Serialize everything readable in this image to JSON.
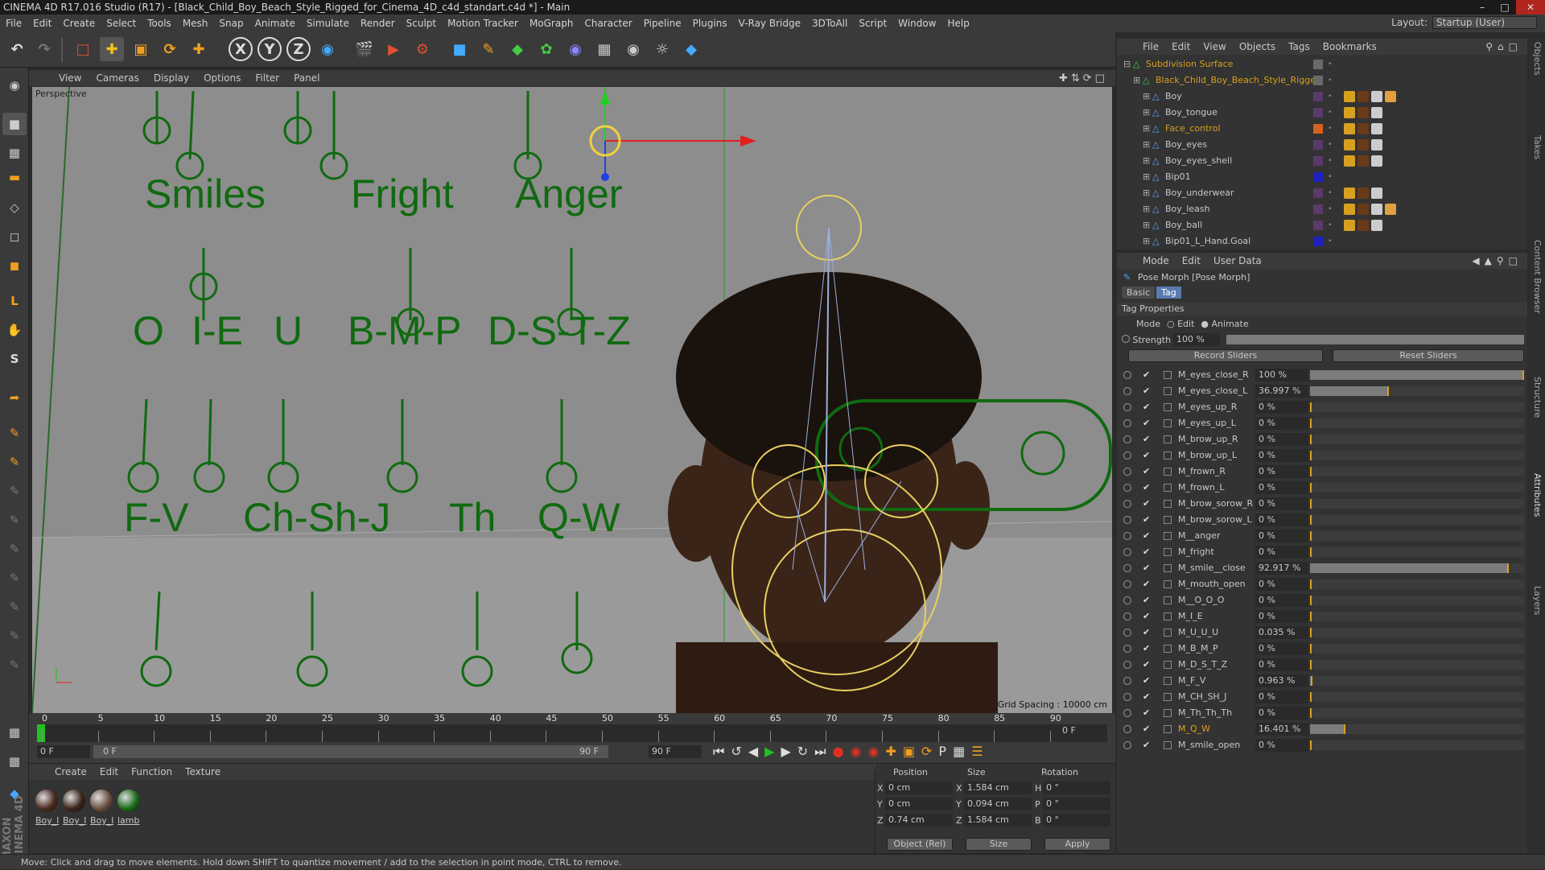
{
  "title": "CINEMA 4D R17.016 Studio (R17) - [Black_Child_Boy_Beach_Style_Rigged_for_Cinema_4D_c4d_standart.c4d *] - Main",
  "menu": [
    "File",
    "Edit",
    "Create",
    "Select",
    "Tools",
    "Mesh",
    "Snap",
    "Animate",
    "Simulate",
    "Render",
    "Sculpt",
    "Motion Tracker",
    "MoGraph",
    "Character",
    "Pipeline",
    "Plugins",
    "V-Ray Bridge",
    "3DToAll",
    "Script",
    "Window",
    "Help"
  ],
  "layout": {
    "label": "Layout:",
    "value": "Startup (User)"
  },
  "viewport": {
    "menu": [
      "View",
      "Cameras",
      "Display",
      "Options",
      "Filter",
      "Panel"
    ],
    "label": "Perspective",
    "grid_spacing": "Grid Spacing : 10000 cm",
    "row1": [
      "Smiles",
      "Fright",
      "Anger"
    ],
    "row2": [
      "O",
      "I-E",
      "U",
      "B-M-P",
      "D-S-T-Z"
    ],
    "row3": [
      "F-V",
      "Ch-Sh-J",
      "Th",
      "Q-W"
    ]
  },
  "timeline": {
    "ticks": [
      "0",
      "5",
      "10",
      "15",
      "20",
      "25",
      "30",
      "35",
      "40",
      "45",
      "50",
      "55",
      "60",
      "65",
      "70",
      "75",
      "80",
      "85",
      "90"
    ],
    "current_frame": "0 F",
    "start": "0 F",
    "range_start": "0 F",
    "range_end": "90 F",
    "end": "90 F",
    "right_frame": "0 F"
  },
  "materials": {
    "menu": [
      "Create",
      "Edit",
      "Function",
      "Texture"
    ],
    "items": [
      {
        "label": "Boy_l",
        "color": "#4a2a1e"
      },
      {
        "label": "Boy_l",
        "color": "#3a2418"
      },
      {
        "label": "Boy_l",
        "color": "#6a5040"
      },
      {
        "label": "lamb",
        "color": "#1a6a1a"
      }
    ]
  },
  "coords": {
    "headers": [
      "Position",
      "Size",
      "Rotation"
    ],
    "rows": [
      {
        "axis": "X",
        "pos": "0 cm",
        "size_axis": "X",
        "size": "1.584 cm",
        "rot_axis": "H",
        "rot": "0 °"
      },
      {
        "axis": "Y",
        "pos": "0 cm",
        "size_axis": "Y",
        "size": "0.094 cm",
        "rot_axis": "P",
        "rot": "0 °"
      },
      {
        "axis": "Z",
        "pos": "0.74 cm",
        "size_axis": "Z",
        "size": "1.584 cm",
        "rot_axis": "B",
        "rot": "0 °"
      }
    ],
    "mode": "Object (Rel)",
    "size_mode": "Size",
    "apply": "Apply"
  },
  "status": "Move: Click and drag to move elements. Hold down SHIFT to quantize movement / add to the selection in point mode, CTRL to remove.",
  "objects": {
    "menu": [
      "File",
      "Edit",
      "View",
      "Objects",
      "Tags",
      "Bookmarks"
    ],
    "items": [
      {
        "name": "Subdivision Surface",
        "color": "#d8a020",
        "indent": 0,
        "clr": "#6a6a6a"
      },
      {
        "name": "Black_Child_Boy_Beach_Style_Rigged",
        "color": "#d8a020",
        "indent": 1,
        "clr": "#6a6a6a"
      },
      {
        "name": "Boy",
        "color": "#c8c8c8",
        "indent": 2,
        "clr": "#5a3a6a"
      },
      {
        "name": "Boy_tongue",
        "color": "#c8c8c8",
        "indent": 2,
        "clr": "#5a3a6a"
      },
      {
        "name": "Face_control",
        "color": "#d8a020",
        "indent": 2,
        "clr": "#d86020"
      },
      {
        "name": "Boy_eyes",
        "color": "#c8c8c8",
        "indent": 2,
        "clr": "#5a3a6a"
      },
      {
        "name": "Boy_eyes_shell",
        "color": "#c8c8c8",
        "indent": 2,
        "clr": "#5a3a6a"
      },
      {
        "name": "Bip01",
        "color": "#c8c8c8",
        "indent": 2,
        "clr": "#2020c0"
      },
      {
        "name": "Boy_underwear",
        "color": "#c8c8c8",
        "indent": 2,
        "clr": "#5a3a6a"
      },
      {
        "name": "Boy_leash",
        "color": "#c8c8c8",
        "indent": 2,
        "clr": "#5a3a6a"
      },
      {
        "name": "Boy_ball",
        "color": "#c8c8c8",
        "indent": 2,
        "clr": "#5a3a6a"
      },
      {
        "name": "Bip01_L_Hand.Goal",
        "color": "#c8c8c8",
        "indent": 2,
        "clr": "#2020c0"
      }
    ]
  },
  "attributes": {
    "menu": [
      "Mode",
      "Edit",
      "User Data"
    ],
    "title": "Pose Morph [Pose Morph]",
    "tabs": [
      "Basic",
      "Tag"
    ],
    "section": "Tag Properties",
    "mode_label": "Mode",
    "mode_edit": "Edit",
    "mode_animate": "Animate",
    "strength_label": "Strength",
    "strength_value": "100 %",
    "record": "Record Sliders",
    "reset": "Reset Sliders",
    "morphs": [
      {
        "label": "M_eyes_close_R",
        "value": "100 %",
        "frac": 1.0,
        "orange": false
      },
      {
        "label": "M_eyes_close_L",
        "value": "36.997 %",
        "frac": 0.37,
        "orange": false
      },
      {
        "label": "M_eyes_up_R",
        "value": "0 %",
        "frac": 0,
        "orange": false
      },
      {
        "label": "M_eyes_up_L",
        "value": "0 %",
        "frac": 0,
        "orange": false
      },
      {
        "label": "M_brow_up_R",
        "value": "0 %",
        "frac": 0,
        "orange": false
      },
      {
        "label": "M_brow_up_L",
        "value": "0 %",
        "frac": 0,
        "orange": false
      },
      {
        "label": "M_frown_R",
        "value": "0 %",
        "frac": 0,
        "orange": false
      },
      {
        "label": "M_frown_L",
        "value": "0 %",
        "frac": 0,
        "orange": false
      },
      {
        "label": "M_brow_sorow_R",
        "value": "0 %",
        "frac": 0,
        "orange": false
      },
      {
        "label": "M_brow_sorow_L",
        "value": "0 %",
        "frac": 0,
        "orange": false
      },
      {
        "label": "M__anger",
        "value": "0 %",
        "frac": 0,
        "orange": false
      },
      {
        "label": "M_fright",
        "value": "0 %",
        "frac": 0,
        "orange": false
      },
      {
        "label": "M_smile__close",
        "value": "92.917 %",
        "frac": 0.929,
        "orange": false
      },
      {
        "label": "M_mouth_open",
        "value": "0 %",
        "frac": 0,
        "orange": false
      },
      {
        "label": "M__O_O_O",
        "value": "0 %",
        "frac": 0,
        "orange": false
      },
      {
        "label": "M_I_E",
        "value": "0 %",
        "frac": 0,
        "orange": false
      },
      {
        "label": "M_U_U_U",
        "value": "0.035 %",
        "frac": 0.0004,
        "orange": false
      },
      {
        "label": "M_B_M_P",
        "value": "0 %",
        "frac": 0,
        "orange": false
      },
      {
        "label": "M_D_S_T_Z",
        "value": "0 %",
        "frac": 0,
        "orange": false
      },
      {
        "label": "M_F_V",
        "value": "0.963 %",
        "frac": 0.01,
        "orange": false
      },
      {
        "label": "M_CH_SH_J",
        "value": "0 %",
        "frac": 0,
        "orange": false
      },
      {
        "label": "M_Th_Th_Th",
        "value": "0 %",
        "frac": 0,
        "orange": false
      },
      {
        "label": "M_Q_W",
        "value": "16.401 %",
        "frac": 0.164,
        "orange": true
      },
      {
        "label": "M_smile_open",
        "value": "0 %",
        "frac": 0,
        "orange": false
      }
    ]
  },
  "right_tabs": [
    "Objects",
    "Takes",
    "Content Browser",
    "Structure",
    "Attributes",
    "Layers"
  ],
  "brand": "MAXON CINEMA 4D"
}
